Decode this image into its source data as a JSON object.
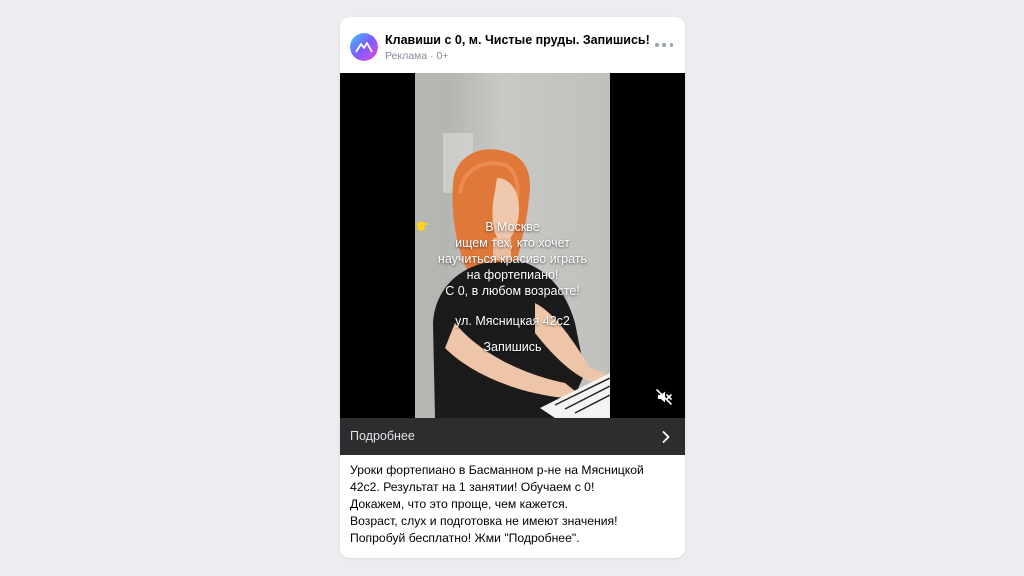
{
  "post": {
    "title": "Клавиши с 0, м. Чистые пруды. Запишись!",
    "sponsored_label": "Реклама",
    "meta_separator": " · ",
    "age_rating": "0+",
    "avatar_icon": "mountain-logo-icon",
    "more_icon": "ellipsis-icon"
  },
  "video": {
    "overlay_lines": [
      "В Москве",
      "ищем тех, кто хочет",
      "научиться красиво играть",
      "на фортепиано!",
      "С 0, в любом возрасте!",
      "ул. Мясницкая 42с2",
      "Запишись"
    ],
    "cta_icon": "pointing-hand-icon",
    "mute_icon": "muted-speaker-icon"
  },
  "cta": {
    "label": "Подробнее",
    "icon": "chevron-right-icon"
  },
  "description": [
    "Уроки фортепиано в Басманном р-не на Мясницкой",
    "42с2. Результат на 1 занятии! Обучаем с 0!",
    "Докажем, что это проще, чем кажется.",
    "Возраст, слух и подготовка не имеют значения!",
    "Попробуй бесплатно! Жми \"Подробнее\"."
  ],
  "colors": {
    "page_background": "#ebedf0",
    "cta_bar": "#2c2d2e",
    "meta_text": "#818c99",
    "hand_emoji": "#ffd21e"
  }
}
